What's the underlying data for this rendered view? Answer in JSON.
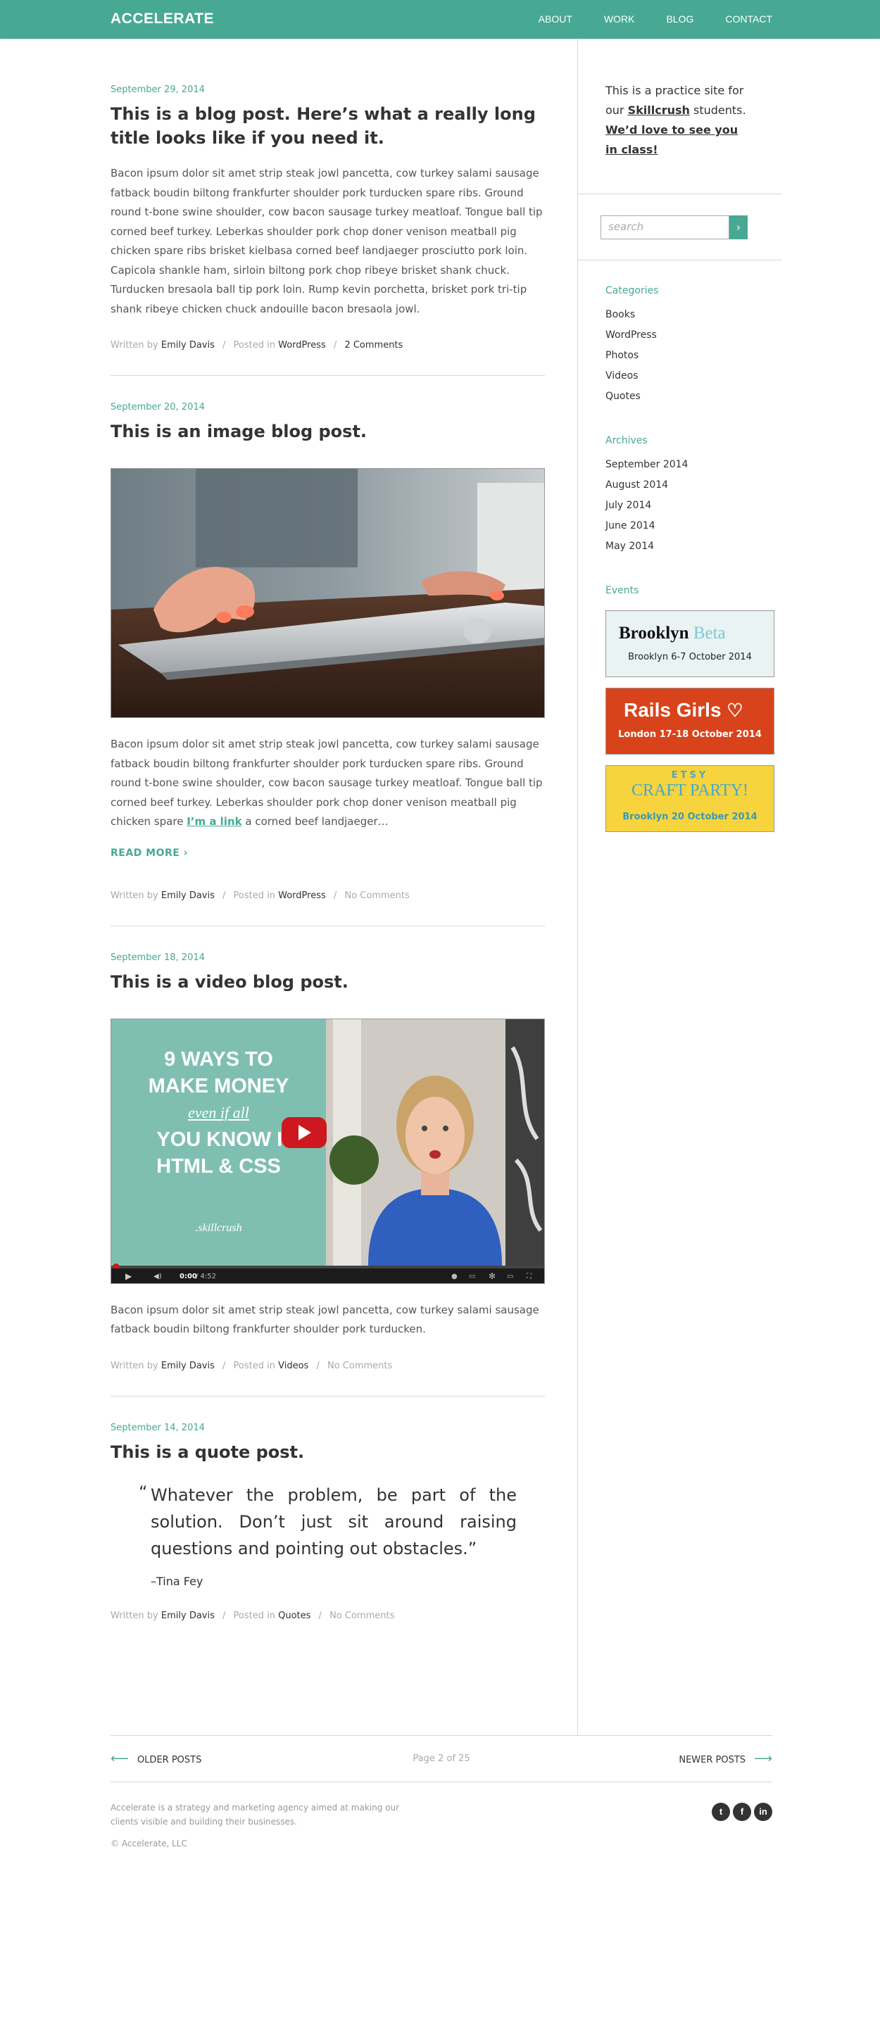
{
  "header": {
    "logo": "ACCELERATE",
    "nav": [
      "ABOUT",
      "WORK",
      "BLOG",
      "CONTACT"
    ]
  },
  "posts": [
    {
      "date": "September 29, 2014",
      "title": "This is a blog post. Here’s what a really long title looks like if you need it.",
      "body": "Bacon ipsum dolor sit amet strip steak jowl pancetta, cow turkey salami sausage fatback boudin biltong frankfurter shoulder pork turducken spare ribs. Ground round t-bone swine shoulder, cow bacon sausage turkey meatloaf. Tongue ball tip corned beef turkey. Leberkas shoulder pork chop doner venison meatball pig chicken spare ribs brisket kielbasa corned beef landjaeger prosciutto pork loin. Capicola shankle ham, sirloin biltong pork chop ribeye brisket shank chuck. Turducken bresaola ball tip pork loin. Rump kevin porchetta, brisket pork tri-tip shank ribeye chicken chuck andouille bacon bresaola jowl.",
      "written_by": "Written by",
      "author": "Emily Davis",
      "posted_in": "Posted in",
      "category": "WordPress",
      "comments": "2 Comments"
    },
    {
      "date": "September 20, 2014",
      "title": "This is an image blog post.",
      "body_before": "Bacon ipsum dolor sit amet strip steak jowl pancetta, cow turkey salami sausage fatback boudin biltong frankfurter shoulder pork turducken spare ribs. Ground round t-bone swine shoulder, cow bacon sausage turkey meatloaf. Tongue ball tip corned beef turkey. Leberkas shoulder pork chop doner venison meatball pig chicken spare ",
      "link": "I’m a link",
      "body_after": " a corned beef landjaeger…",
      "read_more": "READ MORE ›",
      "written_by": "Written by",
      "author": "Emily Davis",
      "posted_in": "Posted in",
      "category": "WordPress",
      "comments": "No Comments"
    },
    {
      "date": "September 18, 2014",
      "title": "This is a video blog post.",
      "video": {
        "lines": [
          "9 WAYS TO",
          "MAKE MONEY",
          "even if all",
          "YOU KNOW IS",
          "HTML & CSS"
        ],
        "brand": ".skillcrush",
        "time_current": "0:00",
        "time_total": " / 4:52"
      },
      "body": "Bacon ipsum dolor sit amet strip steak jowl pancetta, cow turkey salami sausage fatback boudin biltong frankfurter shoulder pork turducken.",
      "written_by": "Written by",
      "author": "Emily Davis",
      "posted_in": "Posted in",
      "category": "Videos",
      "comments": "No Comments"
    },
    {
      "date": "September 14, 2014",
      "title": "This is a quote post.",
      "quote_open": "“",
      "quote": "Whatever the problem, be part of the solution. Don’t just sit around raising questions and pointing out obstacles.”",
      "quote_author": "–Tina Fey",
      "written_by": "Written by",
      "author": "Emily Davis",
      "posted_in": "Posted in",
      "category": "Quotes",
      "comments": "No Comments"
    }
  ],
  "sidebar": {
    "intro_1": "This is a practice site for our ",
    "intro_link": "Skillcrush",
    "intro_2": " students. ",
    "intro_3": "We’d love to see you in class!",
    "search_placeholder": "search",
    "categories_title": "Categories",
    "categories": [
      "Books",
      "WordPress",
      "Photos",
      "Videos",
      "Quotes"
    ],
    "archives_title": "Archives",
    "archives": [
      "September 2014",
      "August 2014",
      "July 2014",
      "June 2014",
      "May 2014"
    ],
    "events_title": "Events",
    "events": [
      {
        "name": "Brooklyn",
        "name2": "Beta",
        "caption": "Brooklyn 6-7 October 2014",
        "bg": "#e9f3f4"
      },
      {
        "name": "Rails Girls",
        "name2": "♡",
        "caption": "London 17-18 October 2014",
        "bg": "#d9431b"
      },
      {
        "name": "ETSY",
        "name2": "CRAFT PARTY!",
        "caption": "Brooklyn 20 October 2014",
        "bg": "#f7d33d"
      }
    ]
  },
  "pagination": {
    "older": "OLDER POSTS",
    "page": "Page 2 of 25",
    "newer": "NEWER POSTS"
  },
  "footer": {
    "about": "Accelerate is a strategy and marketing agency aimed at making our clients visible and building their businesses.",
    "copyright": "© Accelerate, LLC",
    "social": [
      "twitter-icon",
      "facebook-icon",
      "linkedin-icon"
    ]
  },
  "colors": {
    "accent": "#47a994",
    "text": "#333333",
    "muted": "#aaaaaa"
  }
}
